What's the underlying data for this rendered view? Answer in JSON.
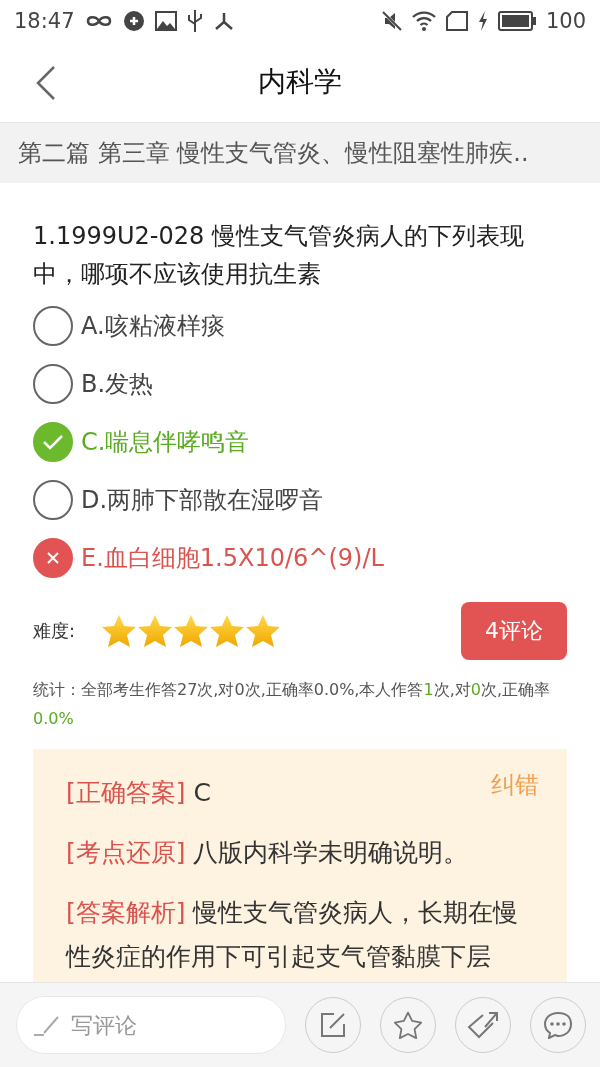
{
  "status_bar": {
    "time": "18:47",
    "battery": "100"
  },
  "header": {
    "title": "内科学"
  },
  "chapter": {
    "text": "第二篇 第三章 慢性支气管炎、慢性阻塞性肺疾.."
  },
  "question": {
    "text": "1.1999U2-028 慢性支气管炎病人的下列表现中，哪项不应该使用抗生素",
    "options": [
      {
        "label": "A.咳粘液样痰",
        "kind": "plain"
      },
      {
        "label": "B.发热",
        "kind": "plain"
      },
      {
        "label": "C.喘息伴哮鸣音",
        "kind": "correct"
      },
      {
        "label": "D.两肺下部散在湿啰音",
        "kind": "plain"
      },
      {
        "label": "E.血白细胞1.5X10/6^(9)/L",
        "kind": "wrong"
      }
    ]
  },
  "difficulty": {
    "label": "难度:",
    "stars": 5
  },
  "comments_button": "4评论",
  "stats": [
    {
      "text": "统计：全部考生作答27次,对0次,正确率0.0%,本人作答",
      "highlight": false
    },
    {
      "text": "1",
      "highlight": true
    },
    {
      "text": "次,对",
      "highlight": false
    },
    {
      "text": "0",
      "highlight": true
    },
    {
      "text": "次,正确率",
      "highlight": false
    },
    {
      "text": "0.0%",
      "highlight": true
    }
  ],
  "answer_card": {
    "correct_link": "纠错",
    "sections": [
      {
        "tag": "[正确答案]",
        "text": "C"
      },
      {
        "tag": "[考点还原]",
        "text": "八版内科学未明确说明。"
      },
      {
        "tag": "[答案解析]",
        "text": "慢性支气管炎病人，长期在慢性炎症的作用下可引起支气管黏膜下层"
      }
    ]
  },
  "bottom_bar": {
    "comment_placeholder": "写评论"
  }
}
